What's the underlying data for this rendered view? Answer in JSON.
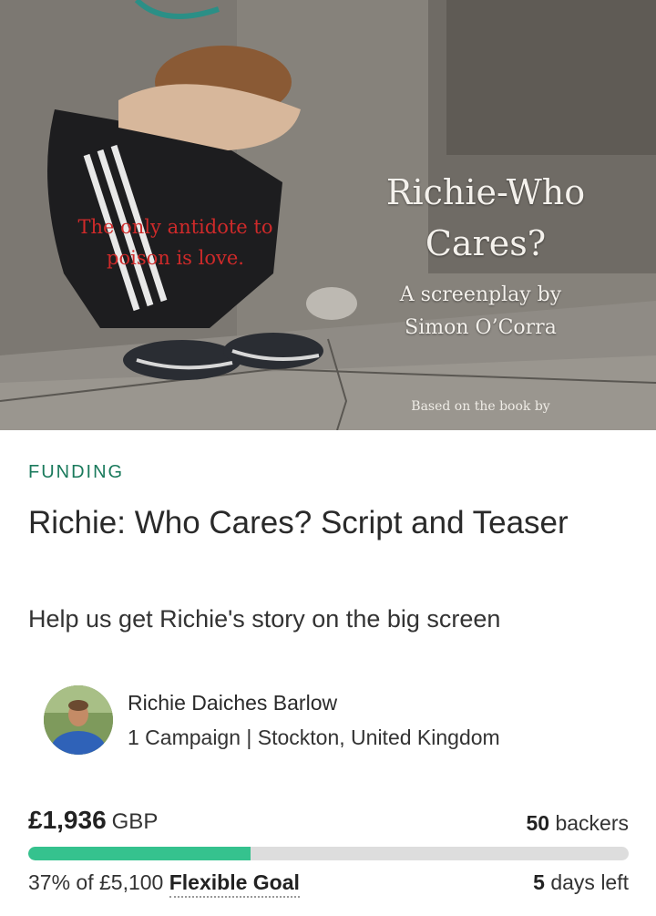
{
  "hero": {
    "poster_title_line1": "Richie-Who",
    "poster_title_line2": "Cares?",
    "poster_byline_line1": "A screenplay by",
    "poster_byline_line2": "Simon O’Corra",
    "poster_tagline_line1": "The only antidote to",
    "poster_tagline_line2": "poison is love.",
    "poster_based_on": "Based on the book by"
  },
  "campaign": {
    "category": "FUNDING",
    "title": "Richie: Who Cares? Script and Teaser",
    "tagline": "Help us get Richie's story on the big screen"
  },
  "owner": {
    "name": "Richie Daiches Barlow",
    "meta": "1 Campaign | Stockton, United Kingdom"
  },
  "funding": {
    "amount": "£1,936",
    "currency": "GBP",
    "backers_count": "50",
    "backers_label": "backers",
    "percent_text": "37% of £5,100",
    "percent_value": 0.37,
    "goal_type": "Flexible Goal",
    "days_count": "5",
    "days_label": "days left"
  },
  "colors": {
    "category": "#1a7a5c",
    "progress_fill": "#35c28e",
    "progress_track": "#dddddd",
    "poster_tagline": "#cf2a2a"
  }
}
